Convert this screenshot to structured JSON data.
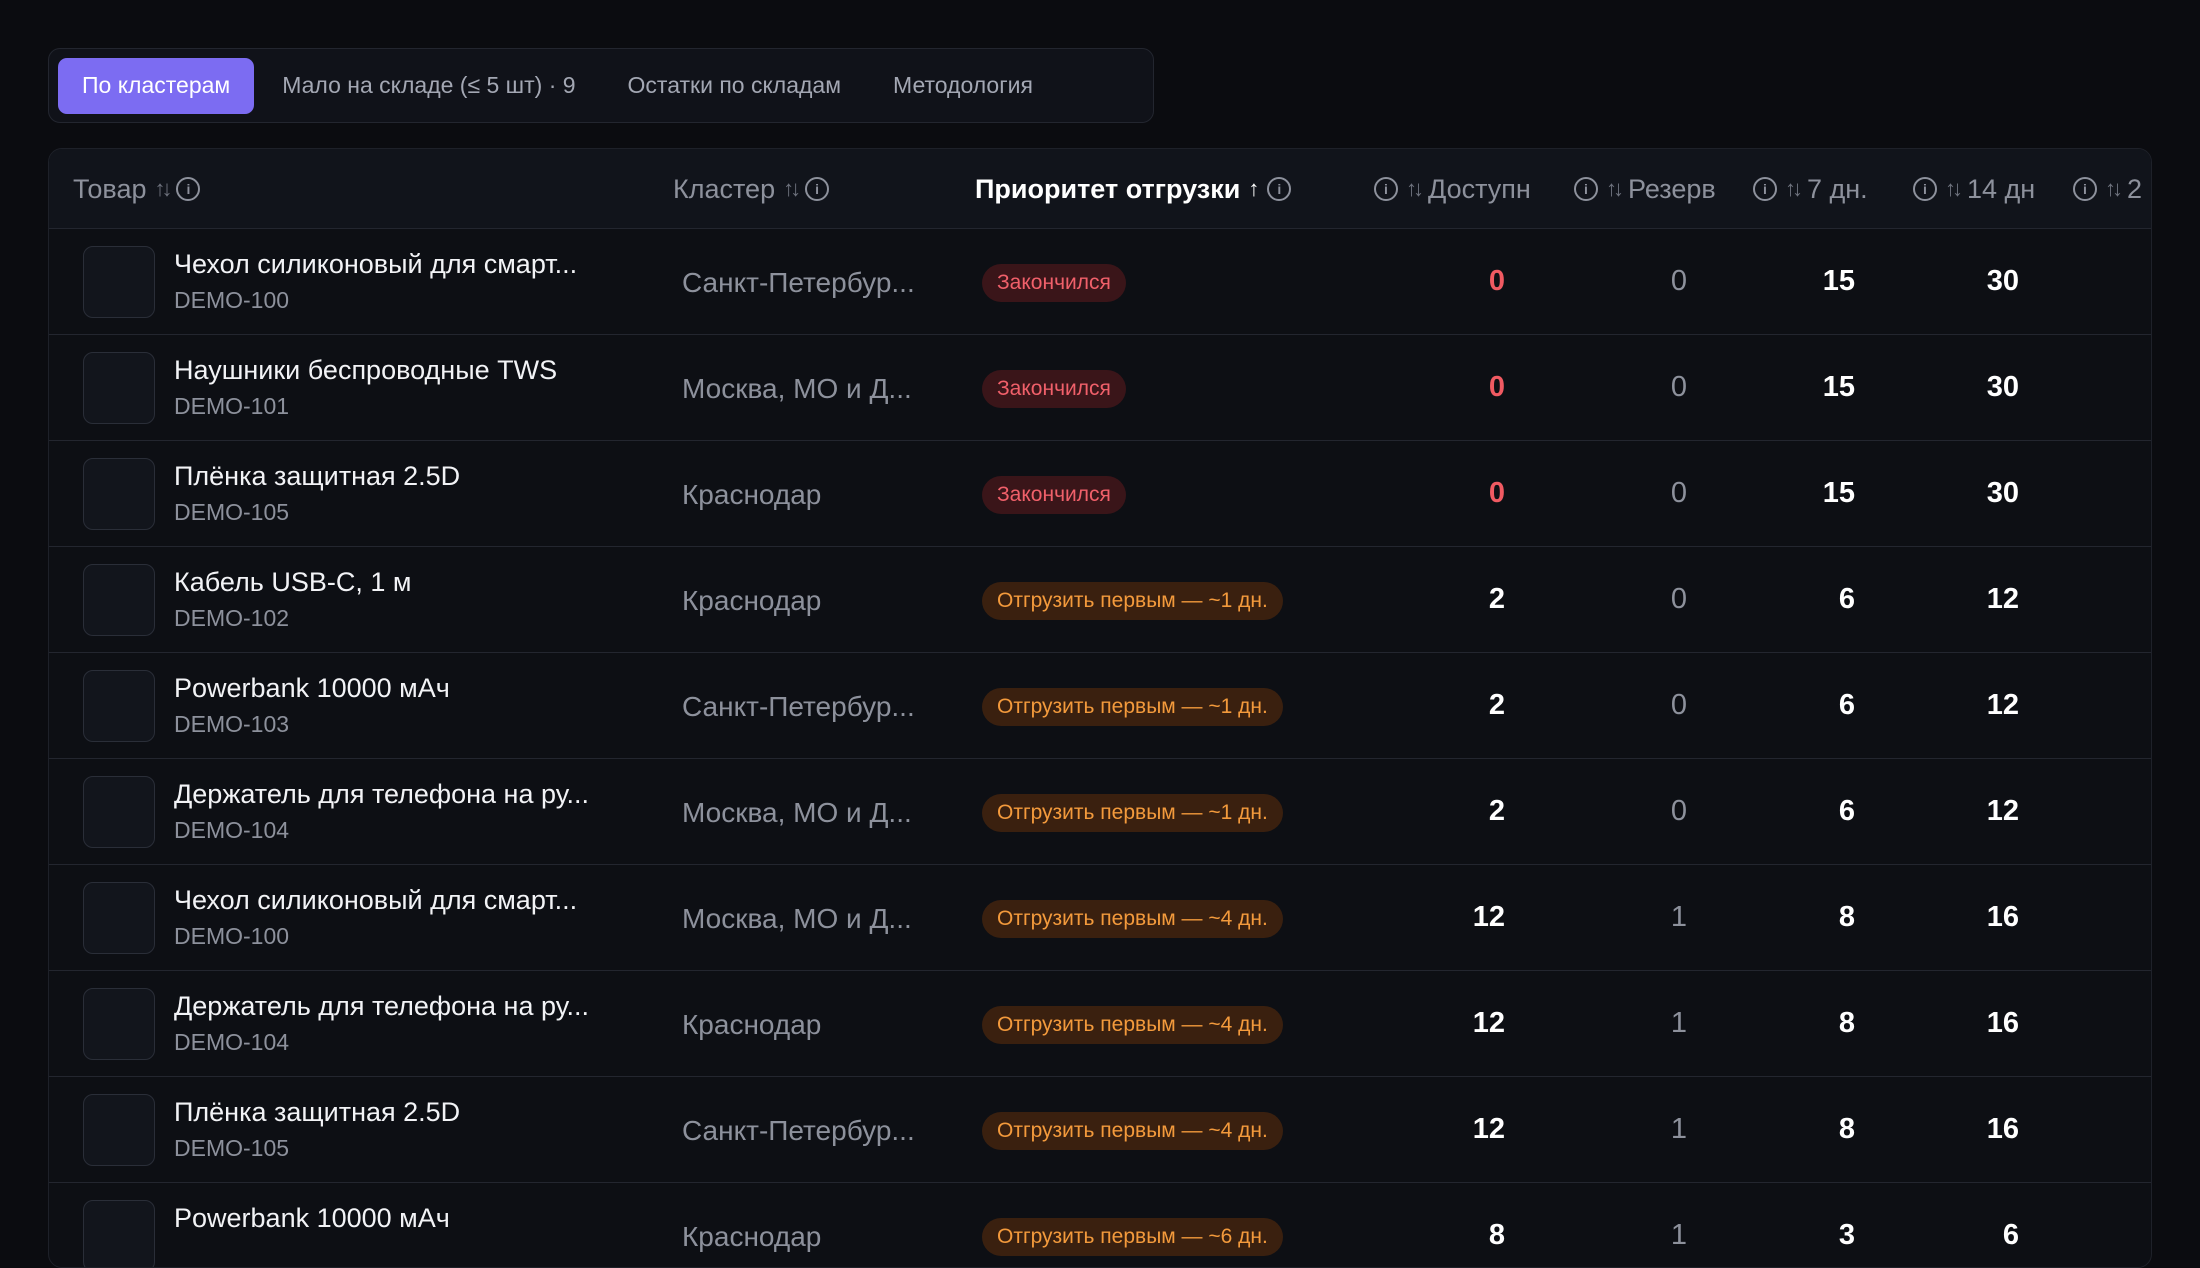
{
  "tabs": [
    {
      "label": "По кластерам",
      "active": true
    },
    {
      "label": "Мало на складе (≤ 5 шт) · 9",
      "active": false
    },
    {
      "label": "Остатки по складам",
      "active": false
    },
    {
      "label": "Методология",
      "active": false
    }
  ],
  "columns": {
    "product": "Товар",
    "cluster": "Кластер",
    "priority": "Приоритет отгрузки",
    "available": "Доступн",
    "reserve": "Резерв",
    "d7": "7 дн.",
    "d14": "14 дн",
    "d_next": "2"
  },
  "rows": [
    {
      "name": "Чехол силиконовый для смарт...",
      "sku": "DEMO-100",
      "cluster": "Санкт-Петербур...",
      "status": "Закончился",
      "status_type": "out",
      "available": "0",
      "reserve": "0",
      "d7": "15",
      "d14": "30"
    },
    {
      "name": "Наушники беспроводные TWS",
      "sku": "DEMO-101",
      "cluster": "Москва, МО и Д...",
      "status": "Закончился",
      "status_type": "out",
      "available": "0",
      "reserve": "0",
      "d7": "15",
      "d14": "30"
    },
    {
      "name": "Плёнка защитная 2.5D",
      "sku": "DEMO-105",
      "cluster": "Краснодар",
      "status": "Закончился",
      "status_type": "out",
      "available": "0",
      "reserve": "0",
      "d7": "15",
      "d14": "30"
    },
    {
      "name": "Кабель USB-C, 1 м",
      "sku": "DEMO-102",
      "cluster": "Краснодар",
      "status": "Отгрузить первым — ~1 дн.",
      "status_type": "ship",
      "available": "2",
      "reserve": "0",
      "d7": "6",
      "d14": "12"
    },
    {
      "name": "Powerbank 10000 мАч",
      "sku": "DEMO-103",
      "cluster": "Санкт-Петербур...",
      "status": "Отгрузить первым — ~1 дн.",
      "status_type": "ship",
      "available": "2",
      "reserve": "0",
      "d7": "6",
      "d14": "12"
    },
    {
      "name": "Держатель для телефона на ру...",
      "sku": "DEMO-104",
      "cluster": "Москва, МО и Д...",
      "status": "Отгрузить первым — ~1 дн.",
      "status_type": "ship",
      "available": "2",
      "reserve": "0",
      "d7": "6",
      "d14": "12"
    },
    {
      "name": "Чехол силиконовый для смарт...",
      "sku": "DEMO-100",
      "cluster": "Москва, МО и Д...",
      "status": "Отгрузить первым — ~4 дн.",
      "status_type": "ship",
      "available": "12",
      "reserve": "1",
      "d7": "8",
      "d14": "16"
    },
    {
      "name": "Держатель для телефона на ру...",
      "sku": "DEMO-104",
      "cluster": "Краснодар",
      "status": "Отгрузить первым — ~4 дн.",
      "status_type": "ship",
      "available": "12",
      "reserve": "1",
      "d7": "8",
      "d14": "16"
    },
    {
      "name": "Плёнка защитная 2.5D",
      "sku": "DEMO-105",
      "cluster": "Санкт-Петербур...",
      "status": "Отгрузить первым — ~4 дн.",
      "status_type": "ship",
      "available": "12",
      "reserve": "1",
      "d7": "8",
      "d14": "16"
    },
    {
      "name": "Powerbank 10000 мАч",
      "sku": "",
      "cluster": "Краснодар",
      "status": "Отгрузить первым — ~6 дн.",
      "status_type": "ship",
      "available": "8",
      "reserve": "1",
      "d7": "3",
      "d14": "6"
    }
  ]
}
